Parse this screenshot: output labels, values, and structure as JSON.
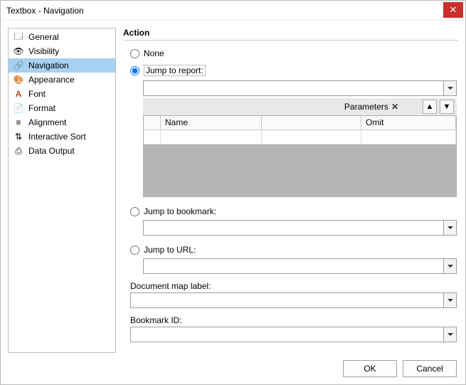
{
  "window": {
    "title": "Textbox - Navigation"
  },
  "sidebar": {
    "items": [
      {
        "label": "General"
      },
      {
        "label": "Visibility"
      },
      {
        "label": "Navigation"
      },
      {
        "label": "Appearance"
      },
      {
        "label": "Font"
      },
      {
        "label": "Format"
      },
      {
        "label": "Alignment"
      },
      {
        "label": "Interactive Sort"
      },
      {
        "label": "Data Output"
      }
    ],
    "selected_index": 2
  },
  "main": {
    "heading": "Action",
    "radios": {
      "none": "None",
      "jump_report": "Jump to report:",
      "jump_bookmark": "Jump to bookmark:",
      "jump_url": "Jump to URL:"
    },
    "selected_radio": "jump_report",
    "jump_report_value": "",
    "parameters_label": "Parameters",
    "grid": {
      "columns": [
        "",
        "Name",
        "",
        "Omit"
      ],
      "rows": []
    },
    "jump_bookmark_value": "",
    "jump_url_value": "",
    "doc_map_label": "Document map label:",
    "doc_map_value": "",
    "bookmark_id_label": "Bookmark ID:",
    "bookmark_id_value": ""
  },
  "footer": {
    "ok": "OK",
    "cancel": "Cancel"
  }
}
